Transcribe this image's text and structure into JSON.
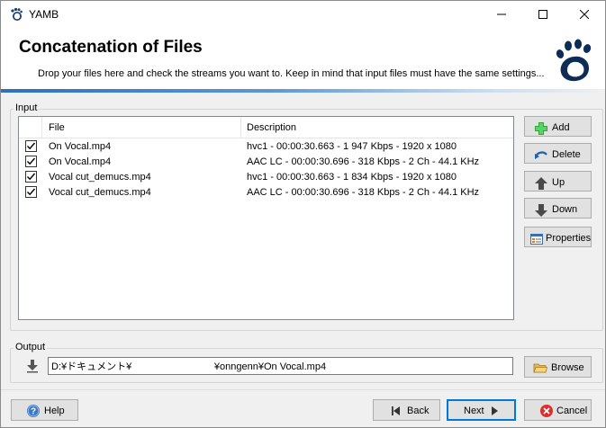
{
  "window": {
    "title": "YAMB"
  },
  "banner": {
    "title": "Concatenation of Files",
    "subtitle": "Drop your files here and check the streams you want to. Keep in mind that input files must have the same settings..."
  },
  "input_group": {
    "label": "Input",
    "columns": [
      "File",
      "Description"
    ],
    "rows": [
      {
        "checked": true,
        "file": "On Vocal.mp4",
        "description": "hvc1 - 00:00:30.663 - 1 947 Kbps - 1920 x 1080"
      },
      {
        "checked": true,
        "file": "On Vocal.mp4",
        "description": "AAC LC - 00:00:30.696 - 318 Kbps - 2 Ch - 44.1 KHz"
      },
      {
        "checked": true,
        "file": "Vocal cut_demucs.mp4",
        "description": "hvc1 - 00:00:30.663 - 1 834 Kbps - 1920 x 1080"
      },
      {
        "checked": true,
        "file": "Vocal cut_demucs.mp4",
        "description": "AAC LC - 00:00:30.696 - 318 Kbps - 2 Ch - 44.1 KHz"
      }
    ]
  },
  "side_buttons": {
    "add": "Add",
    "delete": "Delete",
    "up": "Up",
    "down": "Down",
    "properties": "Properties"
  },
  "output_group": {
    "label": "Output",
    "path": "D:¥ドキュメント¥                              ¥onngenn¥On Vocal.mp4",
    "browse": "Browse"
  },
  "footer": {
    "help": "Help",
    "back": "Back",
    "next": "Next",
    "cancel": "Cancel"
  },
  "colors": {
    "accent": "#0078d7",
    "banner_line": "#2d6fbf",
    "add_icon": "#2fa83a",
    "cancel_icon": "#d9302c",
    "help_icon": "#3b78c8"
  }
}
